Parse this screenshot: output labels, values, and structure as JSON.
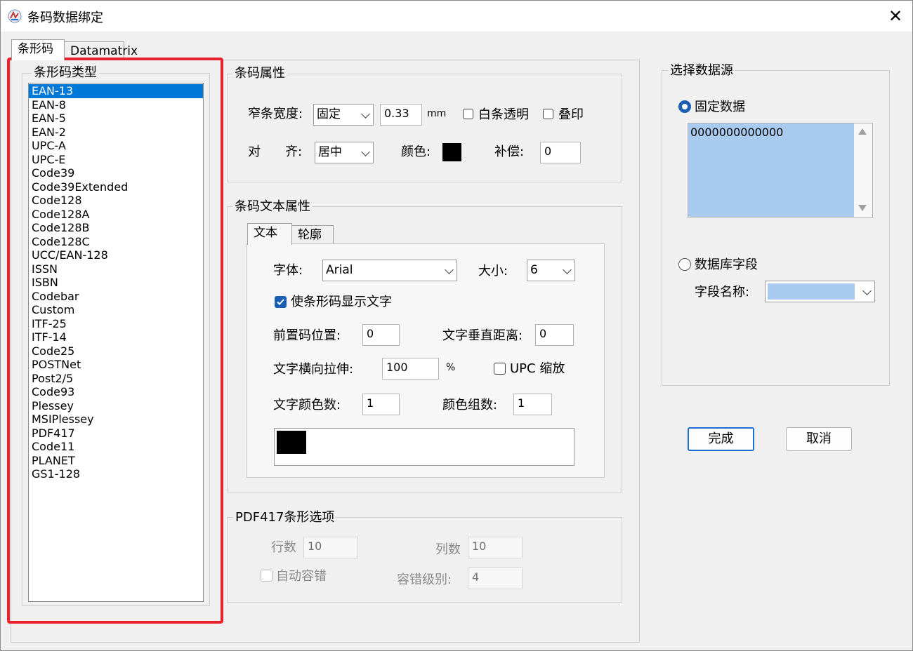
{
  "window": {
    "title": "条码数据绑定",
    "close_label": "✕"
  },
  "tabs": [
    "条形码",
    "Datamatrix"
  ],
  "barcode_type": {
    "group_title": "条形码类型",
    "selected_index": 0,
    "items": [
      "EAN-13",
      "EAN-8",
      "EAN-5",
      "EAN-2",
      "UPC-A",
      "UPC-E",
      "Code39",
      "Code39Extended",
      "Code128",
      "Code128A",
      "Code128B",
      "Code128C",
      "UCC/EAN-128",
      "ISSN",
      "ISBN",
      "Codebar",
      "Custom",
      "ITF-25",
      "ITF-14",
      "Code25",
      "POSTNet",
      "Post2/5",
      "Code93",
      "Plessey",
      "MSIPlessey",
      "PDF417",
      "Code11",
      "PLANET",
      "GS1-128"
    ]
  },
  "barcode_props": {
    "group_title": "条码属性",
    "narrow_width_label": "窄条宽度:",
    "narrow_width_mode": "固定",
    "narrow_width_value": "0.33",
    "unit": "mm",
    "white_transparent_label": "白条透明",
    "overprint_label": "叠印",
    "align_label_a": "对",
    "align_label_b": "齐:",
    "align_value": "居中",
    "color_label": "颜色:",
    "color_value": "#000000",
    "compensation_label": "补偿:",
    "compensation_value": "0"
  },
  "text_props": {
    "group_title": "条码文本属性",
    "tabs": [
      "文本",
      "轮廓"
    ],
    "font_label": "字体:",
    "font_value": "Arial",
    "size_label": "大小:",
    "size_value": "6",
    "show_text_label": "使条形码显示文字",
    "show_text_checked": true,
    "prefix_pos_label": "前置码位置:",
    "prefix_pos_value": "0",
    "vertical_dist_label": "文字垂直距离:",
    "vertical_dist_value": "0",
    "stretch_label": "文字横向拉伸:",
    "stretch_value": "100",
    "stretch_unit": "%",
    "upc_scale_label": "UPC 缩放",
    "color_count_label": "文字颜色数:",
    "color_count_value": "1",
    "color_group_label": "颜色组数:",
    "color_group_value": "1",
    "swatch_color": "#000000"
  },
  "pdf417": {
    "group_title": "PDF417条形选项",
    "rows_label": "行数",
    "rows_value": "10",
    "cols_label": "列数",
    "cols_value": "10",
    "auto_ec_label": "自动容错",
    "ec_level_label": "容错级别:",
    "ec_level_value": "4"
  },
  "datasource": {
    "group_title": "选择数据源",
    "fixed_label": "固定数据",
    "fixed_value": "0000000000000",
    "db_label": "数据库字段",
    "field_name_label": "字段名称:",
    "field_value": ""
  },
  "buttons": {
    "ok": "完成",
    "cancel": "取消"
  },
  "colors": {
    "selection": "#0078d7",
    "highlight_box": "#e8232e",
    "datafield_bg": "#a9cbf0"
  }
}
